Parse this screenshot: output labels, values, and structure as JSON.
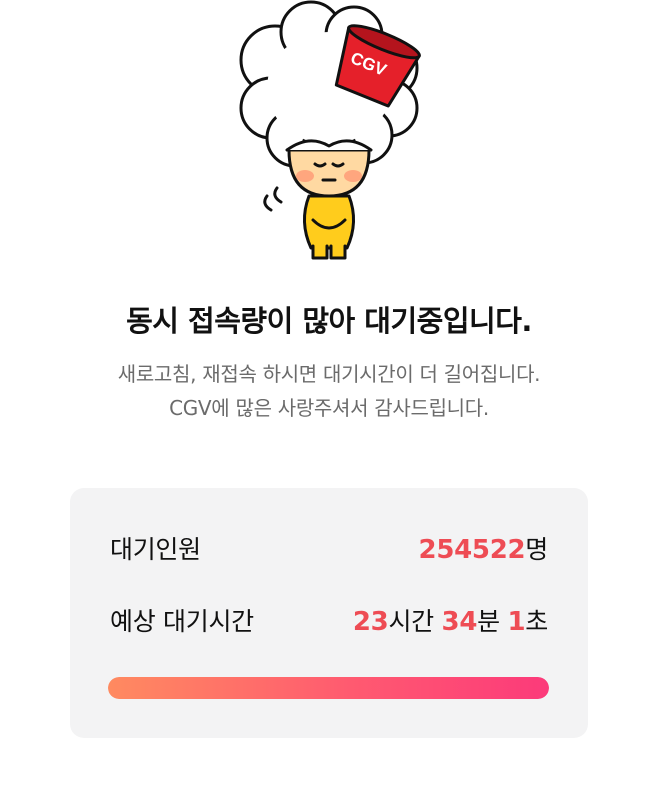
{
  "mascot": {
    "icon": "cgv-bucket-mascot-icon",
    "bucket_text": "CGV"
  },
  "headline": "동시 접속량이 많아 대기중입니다.",
  "notice": {
    "line1": "새로고침, 재접속 하시면 대기시간이 더 길어집니다.",
    "line2": "CGV에 많은 사랑주셔서 감사드립니다."
  },
  "queue": {
    "waiting_label": "대기인원",
    "waiting_count": "254522",
    "waiting_unit": "명",
    "eta_label": "예상 대기시간",
    "hours": "23",
    "hours_unit": "시간",
    "minutes": "34",
    "minutes_unit": "분",
    "seconds": "1",
    "seconds_unit": "초",
    "progress": 1.0
  },
  "colors": {
    "accent": "#ee4c54",
    "progress_start": "#ff8a60",
    "progress_end": "#fc3a7a",
    "card_bg": "#f3f3f4"
  }
}
